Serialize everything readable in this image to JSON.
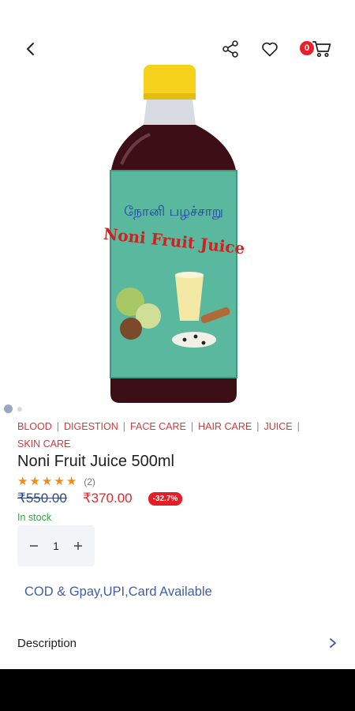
{
  "header": {
    "cart_count": "0",
    "icons": [
      "back-icon",
      "share-icon",
      "heart-icon",
      "cart-icon"
    ]
  },
  "product": {
    "label_tamil": "நோனி பழச்சாறு",
    "label_english": "Noni Fruit Juice",
    "tags": [
      "BLOOD",
      "DIGESTION",
      "FACE CARE",
      "HAIR CARE",
      "JUICE",
      "SKIN CARE"
    ],
    "name": "Noni Fruit Juice 500ml",
    "rating": 5,
    "rating_count": "(2)",
    "old_price": "₹550.00",
    "new_price": "₹370.00",
    "discount": "-32.7%",
    "stock": "In stock",
    "quantity": "1"
  },
  "payment_info": "COD & Gpay,UPI,Card Available",
  "description_label": "Description",
  "colors": {
    "accent_red": "#e22a2a",
    "link_blue": "#3f5ea8",
    "stock_green": "#35a345",
    "star_orange": "#f28a1a"
  }
}
